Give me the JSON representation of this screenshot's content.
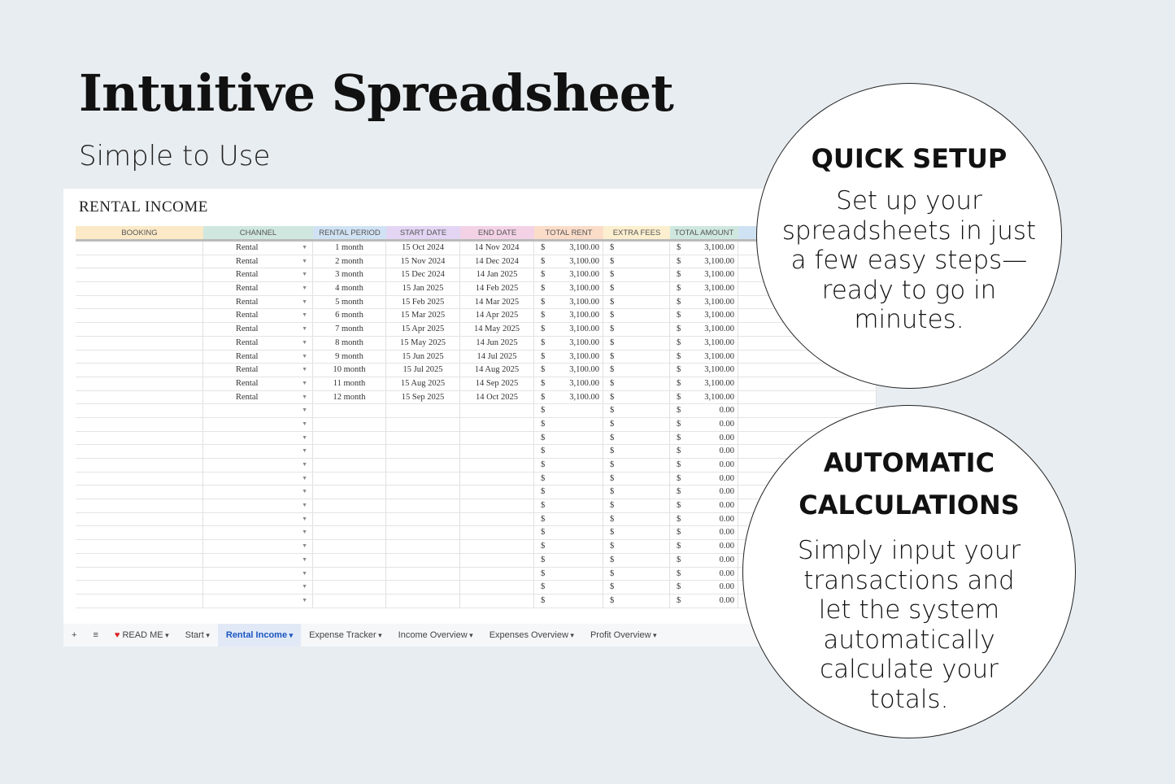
{
  "title": "Intuitive Spreadsheet",
  "subtitle": "Simple to Use",
  "sheet": {
    "title": "RENTAL INCOME",
    "headers": [
      "BOOKING",
      "CHANNEL",
      "RENTAL PERIOD",
      "START DATE",
      "END DATE",
      "TOTAL RENT",
      "EXTRA FEES",
      "TOTAL AMOUNT",
      ""
    ],
    "header_colors": [
      "#fbe9c7",
      "#cfe7df",
      "#d0e2f3",
      "#e3d5f3",
      "#f3d2e6",
      "#fbdcc9",
      "#fcefcf",
      "#cfe8df",
      "#cfe2f3"
    ],
    "rows": [
      [
        "",
        "Rental",
        "1 month",
        "15 Oct 2024",
        "14 Nov 2024",
        "3,100.00",
        "",
        "3,100.00"
      ],
      [
        "",
        "Rental",
        "2 month",
        "15 Nov 2024",
        "14 Dec 2024",
        "3,100.00",
        "",
        "3,100.00"
      ],
      [
        "",
        "Rental",
        "3 month",
        "15 Dec 2024",
        "14 Jan 2025",
        "3,100.00",
        "",
        "3,100.00"
      ],
      [
        "",
        "Rental",
        "4 month",
        "15 Jan 2025",
        "14 Feb 2025",
        "3,100.00",
        "",
        "3,100.00"
      ],
      [
        "",
        "Rental",
        "5 month",
        "15 Feb 2025",
        "14 Mar 2025",
        "3,100.00",
        "",
        "3,100.00"
      ],
      [
        "",
        "Rental",
        "6 month",
        "15 Mar 2025",
        "14 Apr 2025",
        "3,100.00",
        "",
        "3,100.00"
      ],
      [
        "",
        "Rental",
        "7 month",
        "15 Apr 2025",
        "14 May 2025",
        "3,100.00",
        "",
        "3,100.00"
      ],
      [
        "",
        "Rental",
        "8 month",
        "15 May 2025",
        "14 Jun 2025",
        "3,100.00",
        "",
        "3,100.00"
      ],
      [
        "",
        "Rental",
        "9 month",
        "15 Jun 2025",
        "14 Jul 2025",
        "3,100.00",
        "",
        "3,100.00"
      ],
      [
        "",
        "Rental",
        "10 month",
        "15 Jul 2025",
        "14 Aug 2025",
        "3,100.00",
        "",
        "3,100.00"
      ],
      [
        "",
        "Rental",
        "11 month",
        "15 Aug 2025",
        "14 Sep 2025",
        "3,100.00",
        "",
        "3,100.00"
      ],
      [
        "",
        "Rental",
        "12 month",
        "15 Sep 2025",
        "14 Oct 2025",
        "3,100.00",
        "",
        "3,100.00"
      ],
      [
        "",
        "",
        "",
        "",
        "",
        "",
        "",
        "0.00"
      ],
      [
        "",
        "",
        "",
        "",
        "",
        "",
        "",
        "0.00"
      ],
      [
        "",
        "",
        "",
        "",
        "",
        "",
        "",
        "0.00"
      ],
      [
        "",
        "",
        "",
        "",
        "",
        "",
        "",
        "0.00"
      ],
      [
        "",
        "",
        "",
        "",
        "",
        "",
        "",
        "0.00"
      ],
      [
        "",
        "",
        "",
        "",
        "",
        "",
        "",
        "0.00"
      ],
      [
        "",
        "",
        "",
        "",
        "",
        "",
        "",
        "0.00"
      ],
      [
        "",
        "",
        "",
        "",
        "",
        "",
        "",
        "0.00"
      ],
      [
        "",
        "",
        "",
        "",
        "",
        "",
        "",
        "0.00"
      ],
      [
        "",
        "",
        "",
        "",
        "",
        "",
        "",
        "0.00"
      ],
      [
        "",
        "",
        "",
        "",
        "",
        "",
        "",
        "0.00"
      ],
      [
        "",
        "",
        "",
        "",
        "",
        "",
        "",
        "0.00"
      ],
      [
        "",
        "",
        "",
        "",
        "",
        "",
        "",
        "0.00"
      ],
      [
        "",
        "",
        "",
        "",
        "",
        "",
        "",
        "0.00"
      ],
      [
        "",
        "",
        "",
        "",
        "",
        "",
        "",
        "0.00"
      ]
    ],
    "currency": "$",
    "tabs": [
      {
        "label": "READ ME",
        "icon": "heart-icon",
        "active": false
      },
      {
        "label": "Start",
        "active": false
      },
      {
        "label": "Rental Income",
        "active": true
      },
      {
        "label": "Expense Tracker",
        "active": false
      },
      {
        "label": "Income Overview",
        "active": false
      },
      {
        "label": "Expenses Overview",
        "active": false
      },
      {
        "label": "Profit Overview",
        "active": false
      }
    ]
  },
  "callouts": [
    {
      "title_lines": [
        "QUICK SETUP"
      ],
      "body_lines": [
        "Set up your",
        "spreadsheets in just",
        "a few easy steps—",
        "ready to go in",
        "minutes."
      ]
    },
    {
      "title_lines": [
        "AUTOMATIC",
        "CALCULATIONS"
      ],
      "body_lines": [
        "Simply input your",
        "transactions and",
        "let the system",
        "automatically",
        "calculate your",
        "totals."
      ]
    }
  ]
}
